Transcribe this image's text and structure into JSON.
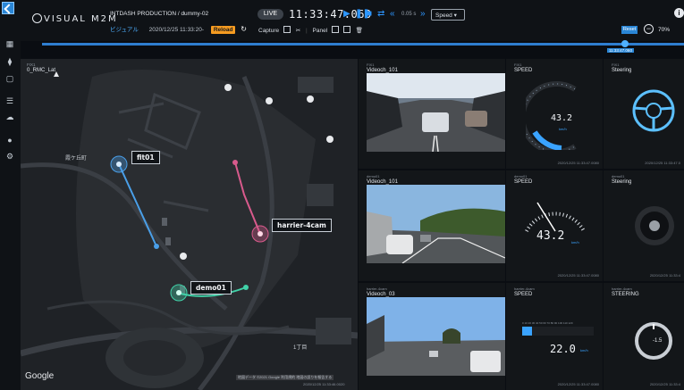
{
  "header": {
    "app_name": "VISUAL M2M",
    "project": "INTDASH PRODUCTION / dummy-02",
    "mode": "ビジュアル",
    "date_prefix": "2020/12/25 11:33:20-",
    "reload_label": "Reload",
    "live_label": "LIVE",
    "current_time": "11:33:47.060",
    "playback_rate": "0.05 s",
    "speed_select": "Speed",
    "capture_label": "Capture",
    "panel_label": "Panel",
    "reset_label": "Reset",
    "zoom_level": "70%",
    "timeline_time": "11:33:47.060",
    "colors": {
      "accent": "#2a86d6",
      "reload": "#f59b21"
    }
  },
  "rail": {
    "icons": [
      "grid-icon",
      "sliders-icon",
      "device-icon",
      "list-icon",
      "cloud-icon",
      "location-icon",
      "settings-icon"
    ]
  },
  "map": {
    "small_label": "FIX1",
    "layer_name": "0_RMC_Lat",
    "town_label": "霞ケ丘町",
    "block_label": "1丁目",
    "google": "Google",
    "attribution": "地図データ ©2021 Google  利用規約  地図の誤りを報告する",
    "timestamp": "2020/12/25 11:33:46.0020",
    "markers": [
      {
        "label": "fit01",
        "color": "#4a9fe8"
      },
      {
        "label": "harrier-4cam",
        "color": "#d85a8c"
      },
      {
        "label": "demo01",
        "color": "#41d1a8"
      }
    ]
  },
  "panels": {
    "row1": {
      "video": {
        "small": "FIX1",
        "title": "Videoch_101"
      },
      "speed": {
        "small": "FIX1",
        "title": "SPEED",
        "value": "43.2",
        "unit": "km/h",
        "ts": "2020/12/25 11:33:47.0080"
      },
      "steering": {
        "small": "FIX1",
        "title": "Steering",
        "ts": "2020/12/25 11:33:47.0"
      }
    },
    "row2": {
      "video": {
        "small": "demo01",
        "title": "Videoch_101"
      },
      "speed": {
        "small": "demo01",
        "title": "SPEED",
        "value": "43.2",
        "unit": "km/h",
        "ts": "2020/12/25 11:33:47.0080"
      },
      "steering": {
        "small": "demo01",
        "title": "Steering",
        "ts": "2020/12/25 11:33:4"
      }
    },
    "row3": {
      "video": {
        "small": "harrier-4cam",
        "title": "Videoch_03"
      },
      "speed": {
        "small": "harrier-4cam",
        "title": "SPEED",
        "value": "22.0",
        "unit": "km/h",
        "bar_fraction": 0.14,
        "scale": "0 10 20 30 40 50 60 70 80 90 100 110 120",
        "ts": "2020/12/25 11:33:47.0080"
      },
      "steering": {
        "small": "harrier-4cam",
        "title": "STEERING",
        "value": "-1.5",
        "ts": "2020/12/25 11:33:4"
      }
    }
  }
}
